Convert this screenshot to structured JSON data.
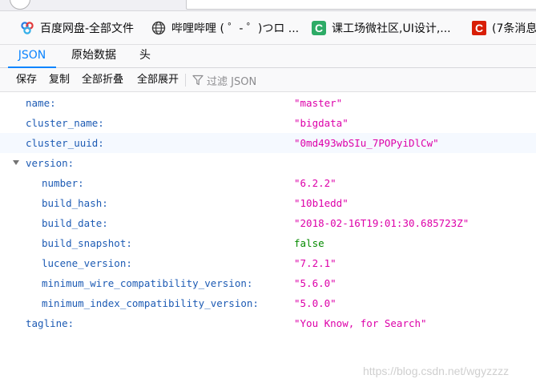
{
  "bookmarks": [
    {
      "icon": "baidu-cloud-icon",
      "label": "百度网盘-全部文件"
    },
    {
      "icon": "globe-icon",
      "label": "哔哩哔哩 ( ゜- ゜)つロ ..."
    },
    {
      "icon": "green-c-icon",
      "label": "课工场微社区,UI设计,..."
    },
    {
      "icon": "red-c-icon",
      "label": "(7条消息"
    }
  ],
  "tabs": [
    {
      "label": "JSON",
      "active": true
    },
    {
      "label": "原始数据",
      "active": false
    },
    {
      "label": "头",
      "active": false
    }
  ],
  "toolbar": {
    "save": "保存",
    "copy": "复制",
    "collapse_all": "全部折叠",
    "expand_all": "全部展开",
    "filter_placeholder": "过滤 JSON"
  },
  "json_rows": [
    {
      "key": "name:",
      "value": "\"master\"",
      "type": "string",
      "indent": 0,
      "highlight": false
    },
    {
      "key": "cluster_name:",
      "value": "\"bigdata\"",
      "type": "string",
      "indent": 0,
      "highlight": false
    },
    {
      "key": "cluster_uuid:",
      "value": "\"0md493wbSIu_7POPyiDlCw\"",
      "type": "string",
      "indent": 0,
      "highlight": true
    },
    {
      "key": "version:",
      "value": "",
      "type": "object",
      "indent": 0,
      "highlight": false
    },
    {
      "key": "number:",
      "value": "\"6.2.2\"",
      "type": "string",
      "indent": 1,
      "highlight": false
    },
    {
      "key": "build_hash:",
      "value": "\"10b1edd\"",
      "type": "string",
      "indent": 1,
      "highlight": false
    },
    {
      "key": "build_date:",
      "value": "\"2018-02-16T19:01:30.685723Z\"",
      "type": "string",
      "indent": 1,
      "highlight": false
    },
    {
      "key": "build_snapshot:",
      "value": "false",
      "type": "bool",
      "indent": 1,
      "highlight": false
    },
    {
      "key": "lucene_version:",
      "value": "\"7.2.1\"",
      "type": "string",
      "indent": 1,
      "highlight": false
    },
    {
      "key": "minimum_wire_compatibility_version:",
      "value": "\"5.6.0\"",
      "type": "string",
      "indent": 1,
      "highlight": false
    },
    {
      "key": "minimum_index_compatibility_version:",
      "value": "\"5.0.0\"",
      "type": "string",
      "indent": 1,
      "highlight": false
    },
    {
      "key": "tagline:",
      "value": "\"You Know, for Search\"",
      "type": "string",
      "indent": 0,
      "highlight": false
    }
  ],
  "watermark": "https://blog.csdn.net/wgyzzzz",
  "colors": {
    "accent": "#0a84ff",
    "key": "#1d5bb4",
    "string": "#dd00a9",
    "bool": "#058b00"
  }
}
